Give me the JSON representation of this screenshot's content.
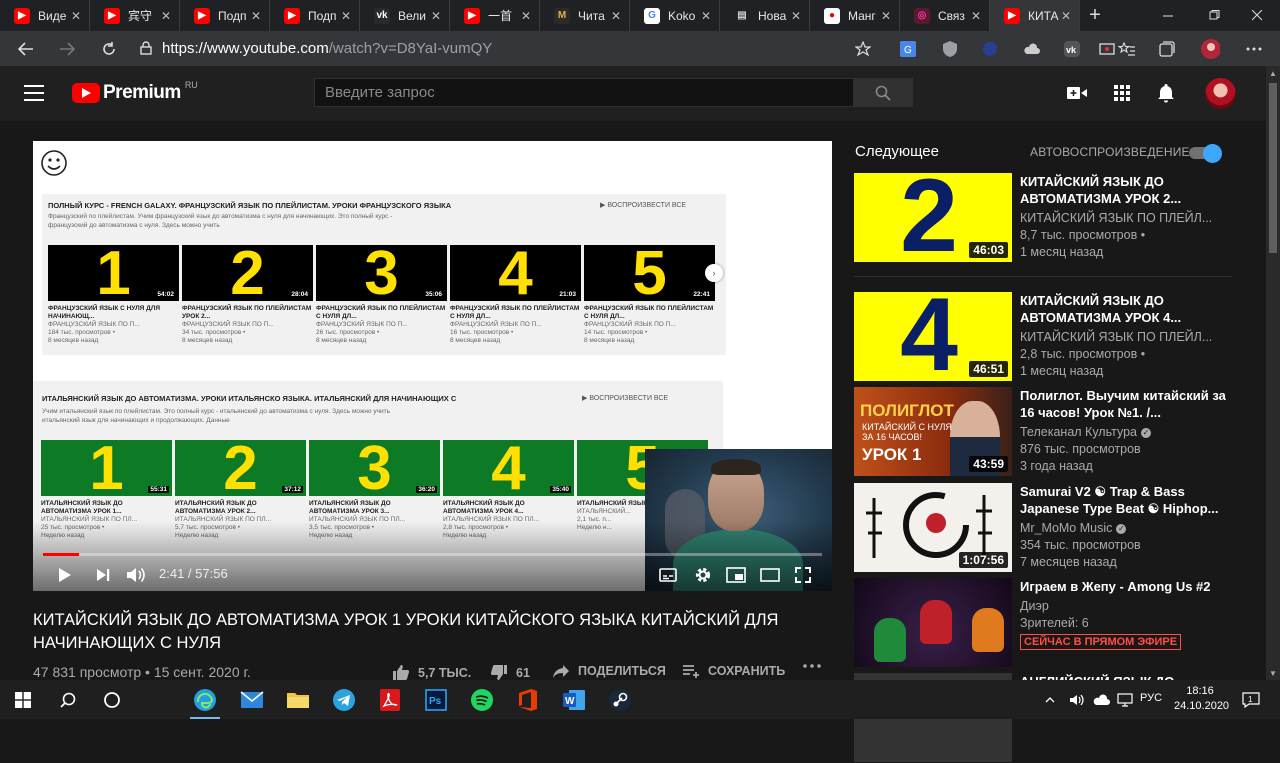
{
  "browser": {
    "tabs": [
      {
        "label": "Виде",
        "fav": "youtube",
        "active": false
      },
      {
        "label": "宾守",
        "fav": "youtube",
        "active": false
      },
      {
        "label": "Подп",
        "fav": "youtube",
        "active": false
      },
      {
        "label": "Подп",
        "fav": "youtube",
        "active": false
      },
      {
        "label": "Вели",
        "fav": "vk",
        "active": false
      },
      {
        "label": "一首",
        "fav": "youtube",
        "active": false
      },
      {
        "label": "Чита",
        "fav": "manga",
        "active": false
      },
      {
        "label": "Koko",
        "fav": "google",
        "active": false
      },
      {
        "label": "Нова",
        "fav": "newtab",
        "active": false
      },
      {
        "label": "Манг",
        "fav": "red",
        "active": false
      },
      {
        "label": "Связ",
        "fav": "circle",
        "active": false
      },
      {
        "label": "КИТА",
        "fav": "youtube",
        "active": true
      }
    ],
    "url_host": "https://www.youtube.com",
    "url_path": "/watch?v=D8YaI-vumQY"
  },
  "yt": {
    "logo_word": "Premium",
    "country": "RU",
    "search_placeholder": "Введите запрос"
  },
  "player": {
    "playlist1": {
      "title": "ПОЛНЫЙ КУРС - FRENCH GALAXY. ФРАНЦУЗСКИЙ ЯЗЫК ПО ПЛЕЙЛИСТАМ. УРОКИ ФРАНЦУЗСКОГО ЯЗЫКА",
      "desc": "Французский по плейлистам. Учим французский язык до автоматизма с нуля для начинающих. Это полный курс - французский до автоматизма с нуля. Здесь можно учить",
      "play_all": "▶ ВОСПРОИЗВЕСТИ ВСЕ",
      "items": [
        {
          "num": "1",
          "dur": "54:02",
          "title": "ФРАНЦУЗСКИЙ ЯЗЫК С НУЛЯ ДЛЯ НАЧИНАЮЩ...",
          "ch": "ФРАНЦУЗСКИЙ ЯЗЫК ПО П...",
          "views": "184 тыс. просмотров •",
          "age": "8 месяцев назад"
        },
        {
          "num": "2",
          "dur": "28:04",
          "title": "ФРАНЦУЗСКИЙ ЯЗЫК ПО ПЛЕЙЛИСТАМ УРОК 2...",
          "ch": "ФРАНЦУЗСКИЙ ЯЗЫК ПО П...",
          "views": "34 тыс. просмотров •",
          "age": "8 месяцев назад"
        },
        {
          "num": "3",
          "dur": "35:06",
          "title": "ФРАНЦУЗСКИЙ ЯЗЫК ПО ПЛЕЙЛИСТАМ С НУЛЯ ДЛ...",
          "ch": "ФРАНЦУЗСКИЙ ЯЗЫК ПО П...",
          "views": "26 тыс. просмотров •",
          "age": "8 месяцев назад"
        },
        {
          "num": "4",
          "dur": "21:03",
          "title": "ФРАНЦУЗСКИЙ ЯЗЫК ПО ПЛЕЙЛИСТАМ С НУЛЯ ДЛ...",
          "ch": "ФРАНЦУЗСКИЙ ЯЗЫК ПО П...",
          "views": "16 тыс. просмотров •",
          "age": "8 месяцев назад"
        },
        {
          "num": "5",
          "dur": "22:41",
          "title": "ФРАНЦУЗСКИЙ ЯЗЫК ПО ПЛЕЙЛИСТАМ С НУЛЯ ДЛ...",
          "ch": "ФРАНЦУЗСКИЙ ЯЗЫК ПО П...",
          "views": "14 тыс. просмотров •",
          "age": "8 месяцев назад"
        }
      ]
    },
    "playlist2": {
      "title": "ИТАЛЬЯНСКИЙ ЯЗЫК ДО АВТОМАТИЗМА. УРОКИ ИТАЛЬЯНСКО ЯЗЫКА. ИТАЛЬЯНСКИЙ ДЛЯ НАЧИНАЮЩИХ С",
      "desc": "Учим итальянский язык по плейлистам. Это полный курс - итальянский до автоматизма с нуля. Здесь можно учить итальянский язык для начинающих и продолжающих. Данные",
      "play_all": "▶ ВОСПРОИЗВЕСТИ ВСЕ",
      "items": [
        {
          "num": "1",
          "dur": "55:31",
          "title": "ИТАЛЬЯНСКИЙ ЯЗЫК ДО АВТОМАТИЗМА УРОК 1...",
          "ch": "ИТАЛЬЯНСКИЙ ЯЗЫК ПО ПЛ...",
          "views": "25 тыс. просмотров •",
          "age": "Неделю назад"
        },
        {
          "num": "2",
          "dur": "37:12",
          "title": "ИТАЛЬЯНСКИЙ ЯЗЫК ДО АВТОМАТИЗМА УРОК 2...",
          "ch": "ИТАЛЬЯНСКИЙ ЯЗЫК ПО ПЛ...",
          "views": "5,7 тыс. просмотров •",
          "age": "Неделю назад"
        },
        {
          "num": "3",
          "dur": "36:20",
          "title": "ИТАЛЬЯНСКИЙ ЯЗЫК ДО АВТОМАТИЗМА УРОК 3...",
          "ch": "ИТАЛЬЯНСКИЙ ЯЗЫК ПО ПЛ...",
          "views": "3,5 тыс. просмотров •",
          "age": "Неделю назад"
        },
        {
          "num": "4",
          "dur": "35:40",
          "title": "ИТАЛЬЯНСКИЙ ЯЗЫК ДО АВТОМАТИЗМА УРОК 4...",
          "ch": "ИТАЛЬЯНСКИЙ ЯЗЫК ПО ПЛ...",
          "views": "2,8 тыс. просмотров •",
          "age": "Неделю назад"
        },
        {
          "num": "5",
          "dur": "",
          "title": "ИТАЛЬЯНСКИЙ ЯЗЫК...",
          "ch": "ИТАЛЬЯНСКИЙ...",
          "views": "2,1 тыс. п...",
          "age": "Неделю н..."
        }
      ]
    },
    "time_current": "2:41",
    "time_total": "57:56",
    "time_sep": " / ",
    "progress": 0.046
  },
  "video": {
    "title": "КИТАЙСКИЙ ЯЗЫК ДО АВТОМАТИЗМА УРОК 1 УРОКИ КИТАЙСКОГО ЯЗЫКА КИТАЙСКИЙ ДЛЯ НАЧИНАЮЩИХ С НУЛЯ",
    "meta": "47 831 просмотр • 15 сент. 2020 г.",
    "likes": "5,7 ТЫС.",
    "dislikes": "61",
    "share": "ПОДЕЛИТЬСЯ",
    "save": "СОХРАНИТЬ"
  },
  "sidebar": {
    "heading": "Следующее",
    "autoplay_label": "АВТОВОСПРОИЗВЕДЕНИЕ",
    "autoplay_on": true,
    "items": [
      {
        "thumb": "num",
        "num": "2",
        "title": "КИТАЙСКИЙ ЯЗЫК ДО АВТОМАТИЗМА УРОК 2...",
        "channel": "КИТАЙСКИЙ ЯЗЫК ПО ПЛЕЙЛ...",
        "verified": false,
        "meta1": "8,7 тыс. просмотров •",
        "meta2": "1 месяц назад",
        "dur": "46:03",
        "live": ""
      },
      {
        "thumb": "num",
        "num": "4",
        "title": "КИТАЙСКИЙ ЯЗЫК ДО АВТОМАТИЗМА УРОК 4...",
        "channel": "КИТАЙСКИЙ ЯЗЫК ПО ПЛЕЙЛ...",
        "verified": false,
        "meta1": "2,8 тыс. просмотров •",
        "meta2": "1 месяц назад",
        "dur": "46:51",
        "live": ""
      },
      {
        "thumb": "poliglot",
        "thumb_big": "ПОЛИГЛОТ",
        "thumb_small": "КИТАЙСКИЙ С НУЛЯ ЗА 16 ЧАСОВ!",
        "thumb_lesson": "УРОК 1",
        "title": "Полиглот. Выучим китайский за 16 часов! Урок №1. /...",
        "channel": "Телеканал Культура",
        "verified": true,
        "meta1": "876 тыс. просмотров",
        "meta2": "3 года назад",
        "dur": "43:59",
        "live": ""
      },
      {
        "thumb": "samurai",
        "title": "Samurai V2 ☯ Trap & Bass Japanese Type Beat ☯ Hiphop...",
        "channel": "Mr_MoMo Music",
        "verified": true,
        "meta1": "354 тыс. просмотров",
        "meta2": "7 месяцев назад",
        "dur": "1:07:56",
        "live": ""
      },
      {
        "thumb": "among",
        "title": "Играем в Жепу - Among Us #2",
        "channel": "Диэр",
        "verified": false,
        "meta1": "Зрителей: 6",
        "meta2": "",
        "dur": "",
        "live": "СЕЙЧАС В ПРЯМОМ ЭФИРЕ"
      },
      {
        "thumb": "dark",
        "title": "АНГЛИЙСКИЙ ЯЗЫК ДО",
        "channel": "",
        "verified": false,
        "meta1": "",
        "meta2": "",
        "dur": "",
        "live": ""
      }
    ]
  },
  "taskbar": {
    "lang": "РУС",
    "time": "18:16",
    "date": "24.10.2020"
  },
  "colors": {
    "yt_red": "#ff0000",
    "accent_blue": "#3ea6ff",
    "thumb_yellow": "#ffff00",
    "thumb_navy": "#0b1f66",
    "live_red": "#ff4e45"
  }
}
